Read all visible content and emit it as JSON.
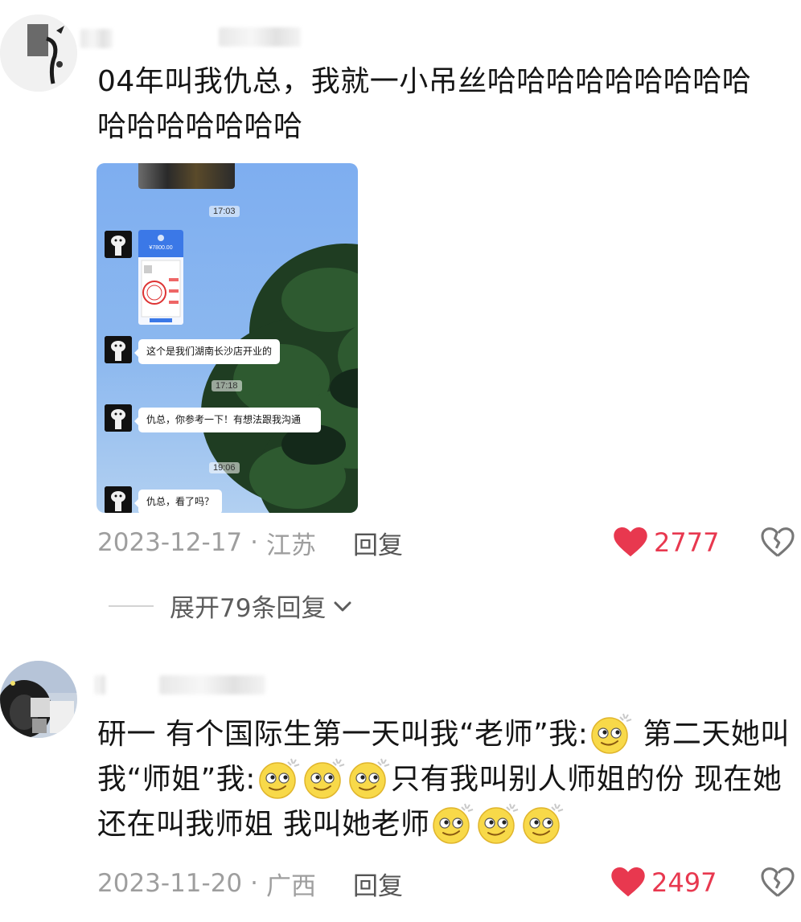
{
  "comments": [
    {
      "text": "04年叫我仇总，我就一小吊丝哈哈哈哈哈哈哈哈哈哈哈哈哈哈哈",
      "text_line1": "04年叫我仇总，我就一小吊丝哈哈哈哈哈哈哈哈哈",
      "text_line2": "哈哈哈哈哈哈哈",
      "date": "2023-12-17",
      "separator": "·",
      "location": "江苏",
      "reply_label": "回复",
      "likes": "2777",
      "expand_label": "展开79条回复"
    },
    {
      "text_seg1": "研一 有个国际生第一天叫我“老师”我:",
      "text_seg2": " 第二天她叫我“师姐”我:",
      "text_seg3": "只有我叫别人师姐的份 现在她还在叫我师姐 我叫她老师",
      "date": "2023-11-20",
      "separator": "·",
      "location": "广西",
      "reply_label": "回复",
      "likes": "2497"
    }
  ],
  "chat_screenshot": {
    "times": [
      "17:03",
      "17:18",
      "19:06"
    ],
    "transfer_amount": "¥7800.00",
    "messages": [
      "这个是我们湖南长沙店开业的",
      "仇总，你参考一下！有想法跟我沟通",
      "仇总，看了吗？"
    ]
  },
  "icons": {
    "like": "heart-icon",
    "dislike": "broken-heart-icon",
    "expand": "chevron-down-icon",
    "emoji": "smirk-emoji-icon"
  },
  "colors": {
    "like": "#e8384f",
    "meta": "#9e9e9e",
    "background": "#ffffff"
  }
}
